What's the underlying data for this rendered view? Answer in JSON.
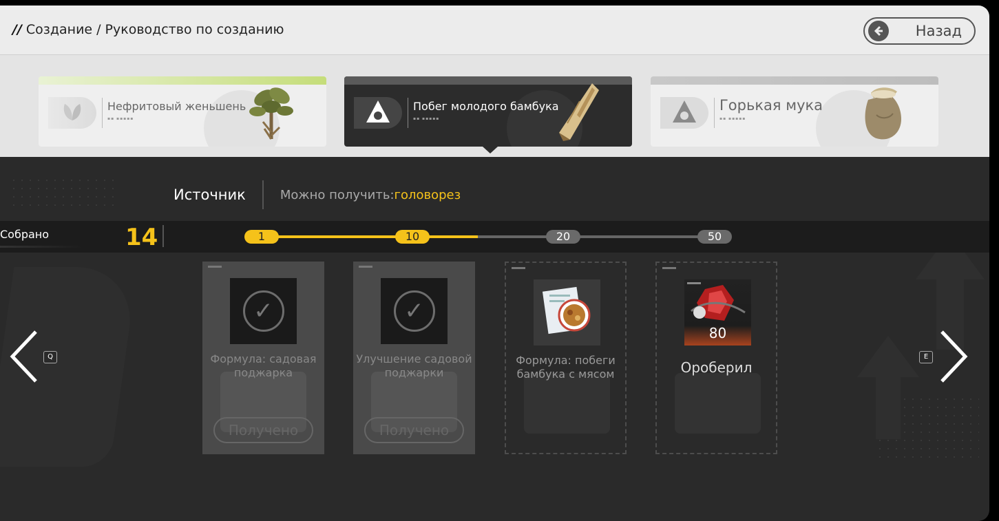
{
  "header": {
    "breadcrumb_prefix": "//",
    "breadcrumb_section": "Создание",
    "breadcrumb_separator": "/",
    "breadcrumb_page": "Руководство по созданию",
    "back_label": "Назад"
  },
  "ingredients": [
    {
      "name": "Нефритовый женьшень",
      "icon": "leaf-icon",
      "state": "inactive"
    },
    {
      "name": "Побег молодого бамбука",
      "icon": "hexagon-icon",
      "state": "selected"
    },
    {
      "name": "Горькая мука",
      "icon": "hexagon-icon",
      "state": "inactive"
    }
  ],
  "source": {
    "label": "Источник",
    "prefix": "Можно получить: ",
    "value": "головорез",
    "value_color": "#f5c21a"
  },
  "progress": {
    "label": "Собрано",
    "count": "14",
    "milestones": [
      "1",
      "10",
      "20",
      "50"
    ]
  },
  "rewards": [
    {
      "title": "Формула: садовая поджарка",
      "status": "Получено",
      "claimed": true
    },
    {
      "title": "Улучшение садовой поджарки",
      "status": "Получено",
      "claimed": true
    },
    {
      "title": "Формула: побеги бамбука с мясом",
      "claimed": false
    },
    {
      "title": "Ороберил",
      "amount": "80",
      "claimed": false
    }
  ],
  "nav": {
    "prev_key": "Q",
    "next_key": "E"
  }
}
